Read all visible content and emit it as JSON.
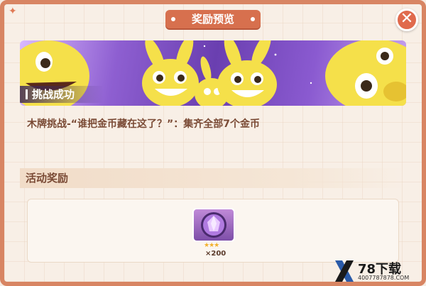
{
  "dialog": {
    "title": "奖励预览",
    "close_icon": "close-icon",
    "accent_color": "#d7704e"
  },
  "banner": {
    "label": "挑战成功",
    "character": "yellow-rabbit-mascots"
  },
  "challenge": {
    "text": "木牌挑战-“谁把金币藏在这了？”：集齐全部7个金币"
  },
  "rewards": {
    "section_title": "活动奖励",
    "items": [
      {
        "icon": "purple-gem-icon",
        "stars": "★★★",
        "count": "×200"
      }
    ]
  },
  "watermark": {
    "logo": "78下载",
    "site": "4007787878.COM"
  }
}
